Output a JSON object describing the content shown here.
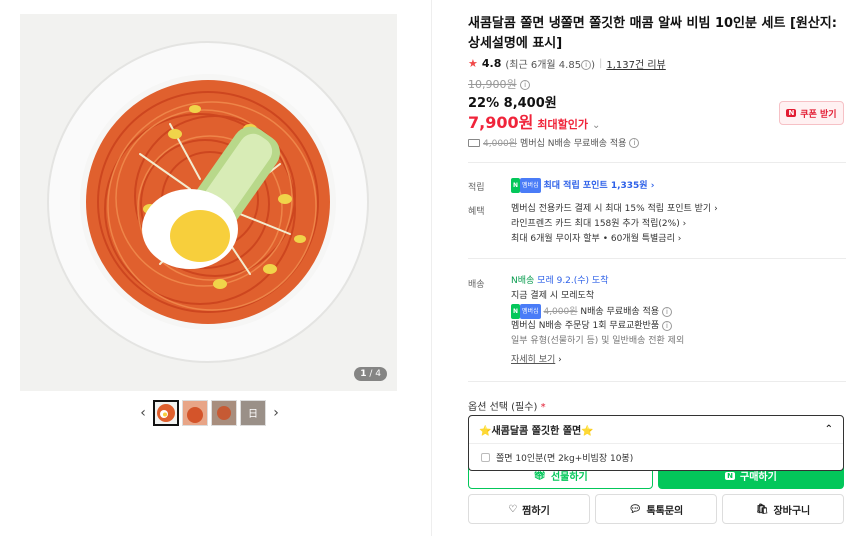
{
  "gallery": {
    "counter_current": "1",
    "counter_total": " / 4",
    "thumb_texts": [
      "",
      "",
      "",
      "日"
    ]
  },
  "product": {
    "title": "새콤달콤 쫄면 냉쫄면 쫄깃한 매콤 알싸 비빔 10인분 세트 [원산지:상세설명에 표시]",
    "rating": "4.8",
    "rating_recent": "(최근 6개월 4.85",
    "reviews": "1,137건 리뷰",
    "original_price": "10,900원",
    "discount_rate": "22%",
    "discount_price": "8,400원",
    "max_price": "7,900원",
    "max_label": "최대할인가",
    "coupon_label": "쿠폰 받기",
    "ship_old": "4,000원",
    "ship_text": "멤버십 N배송 무료배송 적용"
  },
  "benefits": {
    "points_label": "적립",
    "points_badge_n": "N",
    "points_badge_m": "멤버십",
    "points_text": "최대 적립 포인트 1,335원",
    "perks_label": "혜택",
    "perk1": "멤버십 전용카드 결제 시 최대 15% 적립 포인트 받기",
    "perk2": "라인프렌즈 카드 최대 158원 추가 적립(2%)",
    "perk3": "최대 6개월 무이자 할부 • 60개월 특별금리"
  },
  "delivery": {
    "label": "배송",
    "badge": "N배송",
    "arrival": "모레 9.2.(수) 도착",
    "line1": "지금 결제 시 모레도착",
    "badge_n": "N",
    "badge_m": "멤버십",
    "fee_old": "4,000원",
    "fee_text": "N배송 무료배송 적용",
    "line3": "멤버십 N배송 주문당 1회 무료교환반품",
    "line4": "일부 유형(선물하기 등) 및 일반배송 전환 제외",
    "more": "자세히 보기"
  },
  "options": {
    "title": "옵션 선택 (필수)",
    "required_mark": "*",
    "selected_label": "⭐새콤달콤 쫄깃한 쫄면⭐",
    "items": [
      "쫄면 10인분(면 2kg+비빔장 10봉)"
    ]
  },
  "actions": {
    "gift": "선물하기",
    "buy_n": "N",
    "buy": "구매하기",
    "wish": "찜하기",
    "talk": "톡톡문의",
    "cart": "장바구니"
  },
  "colors": {
    "accent_red": "#f0243a",
    "naver_green": "#03c75a",
    "point_blue": "#2e61e8"
  }
}
